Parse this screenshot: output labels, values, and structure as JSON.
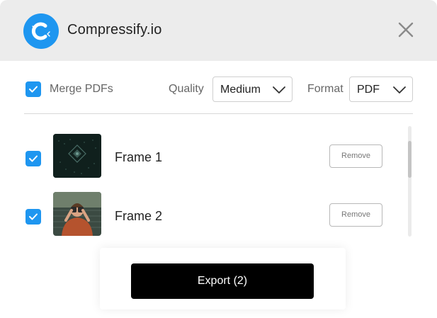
{
  "app": {
    "title": "Compressify.io",
    "logo_icon": "compress-logo-icon",
    "close_icon": "close-icon",
    "accent": "#1e96f0"
  },
  "toolbar": {
    "merge": {
      "label": "Merge PDFs",
      "checked": true
    },
    "quality": {
      "label": "Quality",
      "value": "Medium"
    },
    "format": {
      "label": "Format",
      "value": "PDF"
    }
  },
  "files": [
    {
      "name": "Frame 1",
      "checked": true,
      "remove_label": "Remove",
      "thumb": "dark-pattern-thumbnail"
    },
    {
      "name": "Frame 2",
      "checked": true,
      "remove_label": "Remove",
      "thumb": "person-binoculars-thumbnail"
    }
  ],
  "export": {
    "label": "Export (2)"
  }
}
